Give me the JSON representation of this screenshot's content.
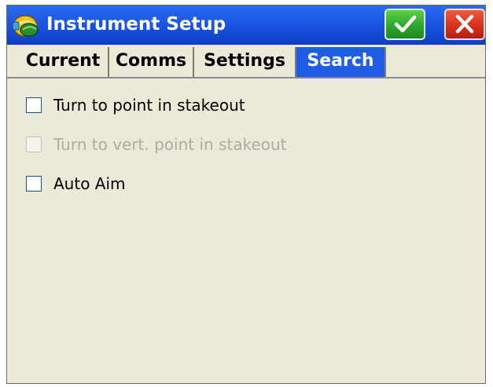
{
  "window": {
    "title": "Instrument Setup",
    "app_icon": "survey-helmet-icon",
    "ok_icon": "checkmark-icon",
    "cancel_icon": "close-icon"
  },
  "tabs": [
    {
      "label": "Current",
      "active": false
    },
    {
      "label": "Comms",
      "active": false
    },
    {
      "label": "Settings",
      "active": false
    },
    {
      "label": "Search",
      "active": true
    }
  ],
  "options": [
    {
      "label": "Turn to point in stakeout",
      "checked": false,
      "enabled": true
    },
    {
      "label": "Turn to vert. point in stakeout",
      "checked": false,
      "enabled": false
    },
    {
      "label": "Auto Aim",
      "checked": false,
      "enabled": true
    }
  ],
  "colors": {
    "titlebar": "#1b56e2",
    "active_tab": "#1e5ee6",
    "panel": "#ece9d8",
    "ok_button": "#2ea82a",
    "cancel_button": "#d8301c",
    "disabled_text": "#acaca4"
  }
}
